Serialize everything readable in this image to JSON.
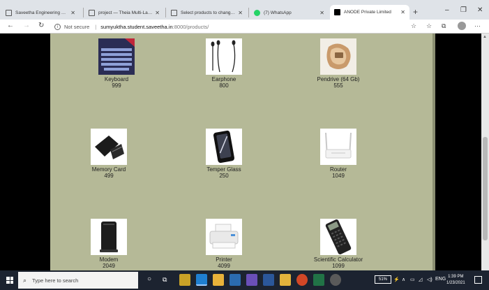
{
  "browser": {
    "tabs": [
      {
        "label": "Saveetha Engineering College",
        "active": false
      },
      {
        "label": "project — Theia Multi-Language",
        "active": false
      },
      {
        "label": "Select products to change | Dj",
        "active": false
      },
      {
        "label": "(7) WhatsApp",
        "active": false
      },
      {
        "label": "ANODE Private Limited",
        "active": true
      }
    ],
    "address": {
      "security_label": "Not secure",
      "host": "sumyuktha.student.saveetha.in",
      "path": ":8000/products/"
    }
  },
  "products": [
    {
      "name": "Keyboard",
      "price": "999",
      "icon": "keyboard-image"
    },
    {
      "name": "Earphone",
      "price": "800",
      "icon": "earphone-image"
    },
    {
      "name": "Pendrive (64 Gb)",
      "price": "555",
      "icon": "pendrive-image"
    },
    {
      "name": "Memory Card",
      "price": "499",
      "icon": "memory-card-image"
    },
    {
      "name": "Temper Glass",
      "price": "250",
      "icon": "temper-glass-image"
    },
    {
      "name": "Router",
      "price": "1049",
      "icon": "router-image"
    },
    {
      "name": "Modem",
      "price": "2049",
      "icon": "modem-image"
    },
    {
      "name": "Printer",
      "price": "4099",
      "icon": "printer-image"
    },
    {
      "name": "Scientific Calculator",
      "price": "1099",
      "icon": "calculator-image"
    }
  ],
  "taskbar": {
    "search_placeholder": "Type here to search",
    "battery": "51%",
    "language": "ENG",
    "time": "1:39 PM",
    "date": "1/23/2021"
  },
  "colors": {
    "page_background": "#b5b997",
    "outer_background": "#000000",
    "taskbar": "#1c2330"
  }
}
